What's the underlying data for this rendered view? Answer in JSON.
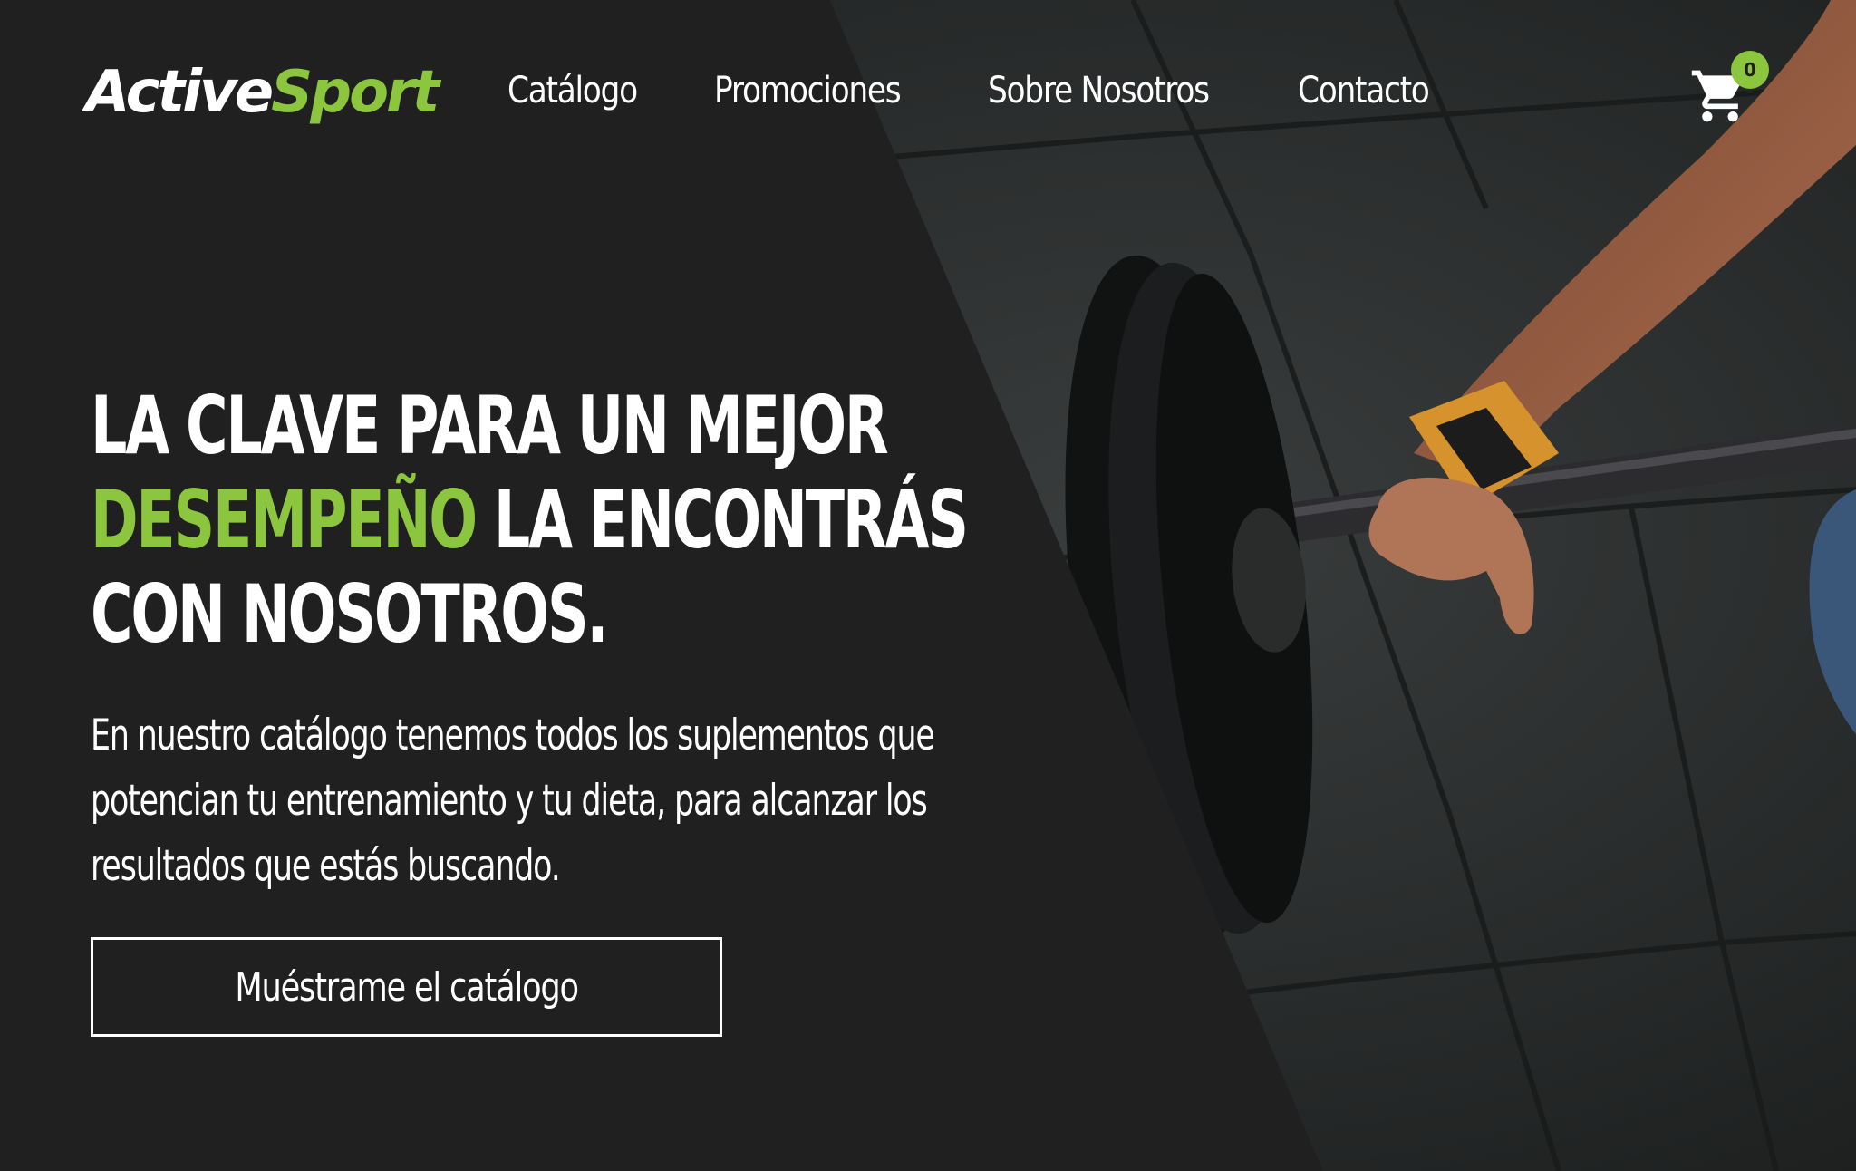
{
  "brand": {
    "logo_part1": "Active",
    "logo_part2": "Sport",
    "accent_color": "#8cc63f",
    "background_color": "#202020"
  },
  "nav": {
    "items": [
      {
        "label": "Catálogo"
      },
      {
        "label": "Promociones"
      },
      {
        "label": "Sobre Nosotros"
      },
      {
        "label": "Contacto"
      }
    ]
  },
  "cart": {
    "icon": "shopping-cart-icon",
    "count": "0"
  },
  "hero": {
    "headline_line1": "LA CLAVE PARA UN MEJOR",
    "headline_accent": "DESEMPEÑO",
    "headline_line2_rest": " LA ENCONTRÁS",
    "headline_line3": "CON NOSOTROS.",
    "lead_line1": "En nuestro catálogo tenemos todos los suplementos que",
    "lead_line2": "potencian tu entrenamiento y tu dieta, para alcanzar los",
    "lead_line3": "resultados que estás buscando.",
    "cta_label": "Muéstrame el catálogo"
  }
}
